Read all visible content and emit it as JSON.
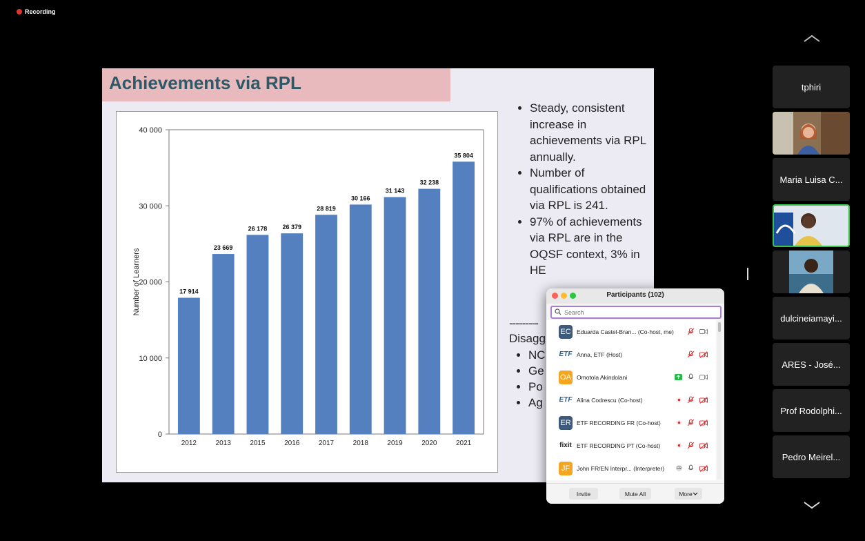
{
  "recording": {
    "label": "Recording"
  },
  "slide": {
    "title": "Achievements via RPL",
    "bullets": [
      "Steady, consistent increase in achievements via RPL annually.",
      "Number of qualifications obtained via RPL is 241.",
      "97% of achievements via RPL are in the OQSF context, 3% in HE"
    ],
    "dash_line": "---------",
    "disagg_heading": "Disagg",
    "disagg_items": [
      "NC",
      "Ge",
      "Po",
      "Ag"
    ]
  },
  "chart_data": {
    "type": "bar",
    "categories": [
      "2012",
      "2013",
      "2015",
      "2016",
      "2017",
      "2018",
      "2019",
      "2020",
      "2021"
    ],
    "values": [
      17914,
      23669,
      26178,
      26379,
      28819,
      30166,
      31143,
      32238,
      35804
    ],
    "value_labels": [
      "17 914",
      "23 669",
      "26 178",
      "26 379",
      "28 819",
      "30 166",
      "31 143",
      "32 238",
      "35 804"
    ],
    "ylabel": "Number of Learners",
    "xlabel": "",
    "yticks": [
      0,
      10000,
      20000,
      30000,
      40000
    ],
    "ytick_labels": [
      "0",
      "10 000",
      "20 000",
      "30 000",
      "40 000"
    ],
    "ylim": [
      0,
      40000
    ],
    "bar_color": "#5580c0",
    "grid": false
  },
  "gallery": {
    "tiles": [
      {
        "label": "tphiri",
        "kind": "name"
      },
      {
        "label": "",
        "kind": "video"
      },
      {
        "label": "Maria Luisa C...",
        "kind": "name"
      },
      {
        "label": "",
        "kind": "video-active"
      },
      {
        "label": "",
        "kind": "video"
      },
      {
        "label": "dulcineiamayi...",
        "kind": "name"
      },
      {
        "label": "ARES - José...",
        "kind": "name"
      },
      {
        "label": "Prof Rodolphi...",
        "kind": "name"
      },
      {
        "label": "Pedro Meirel...",
        "kind": "name"
      }
    ]
  },
  "participants": {
    "title": "Participants (102)",
    "search_placeholder": "Search",
    "rows": [
      {
        "avatar": "EC",
        "avatar_color": "#3d5a7a",
        "name": "Eduarda Castel-Bran... (Co-host, me)",
        "icons": [
          "mic-muted-icon",
          "video-icon"
        ]
      },
      {
        "avatar": "ETF",
        "avatar_color": "logo",
        "name": "Anna, ETF (Host)",
        "icons": [
          "mic-muted-icon",
          "video-off-icon"
        ]
      },
      {
        "avatar": "OA",
        "avatar_color": "#f4a623",
        "name": "Omotola Akindolani",
        "icons": [
          "share-screen-icon",
          "mic-icon",
          "video-icon"
        ]
      },
      {
        "avatar": "ETF",
        "avatar_color": "logo",
        "name": "Alina Codrescu (Co-host)",
        "icons": [
          "record-icon",
          "mic-muted-icon",
          "video-off-icon"
        ]
      },
      {
        "avatar": "ER",
        "avatar_color": "#3d5a7a",
        "name": "ETF RECORDING FR (Co-host)",
        "icons": [
          "record-icon",
          "mic-muted-icon",
          "video-off-icon"
        ]
      },
      {
        "avatar": "fixit",
        "avatar_color": "logo",
        "name": "ETF RECORDING PT (Co-host)",
        "icons": [
          "record-icon",
          "mic-muted-icon",
          "video-off-icon"
        ]
      },
      {
        "avatar": "JF",
        "avatar_color": "#f4a623",
        "name": "John FR/EN Interpr... (Interpreter)",
        "badge": "FR",
        "icons": [
          "mic-icon",
          "video-off-icon"
        ]
      }
    ],
    "buttons": {
      "invite": "Invite",
      "mute_all": "Mute All",
      "more": "More"
    }
  }
}
